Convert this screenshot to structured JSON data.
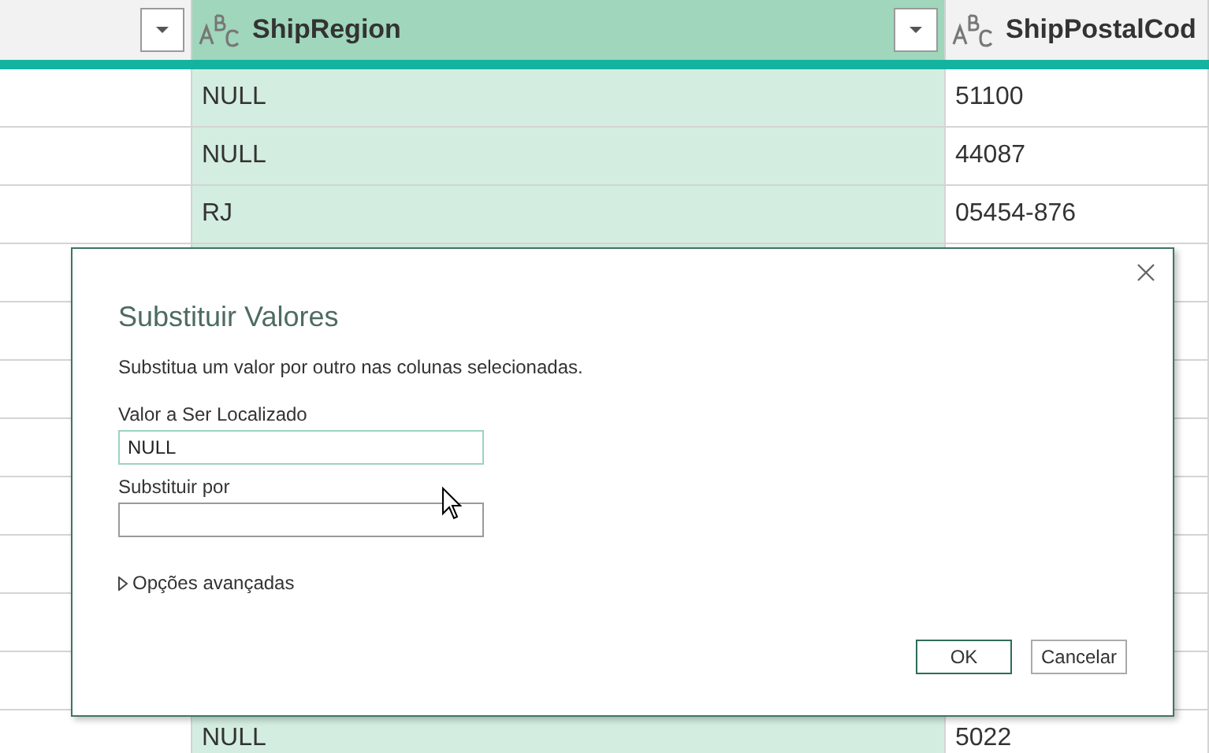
{
  "table": {
    "columns": [
      {
        "selected": false
      },
      {
        "label": "ShipRegion",
        "selected": true
      },
      {
        "label": "ShipPostalCod",
        "selected": false
      }
    ],
    "rows": [
      [
        "",
        "NULL",
        "51100"
      ],
      [
        "",
        "NULL",
        "44087"
      ],
      [
        "",
        "RJ",
        "05454-876"
      ],
      [
        "",
        "NULL",
        "5022"
      ]
    ]
  },
  "dialog": {
    "title": "Substituir Valores",
    "description": "Substitua um valor por outro nas colunas selecionadas.",
    "fields": [
      {
        "label": "Valor a Ser Localizado",
        "value": "NULL",
        "focused": true
      },
      {
        "label": "Substituir por",
        "focused": false
      }
    ],
    "advanced": {
      "label": "Opções avançadas",
      "expanded": false
    },
    "buttons": [
      {
        "label": "OK",
        "default": true
      },
      {
        "label": "Cancelar",
        "default": false
      }
    ]
  }
}
